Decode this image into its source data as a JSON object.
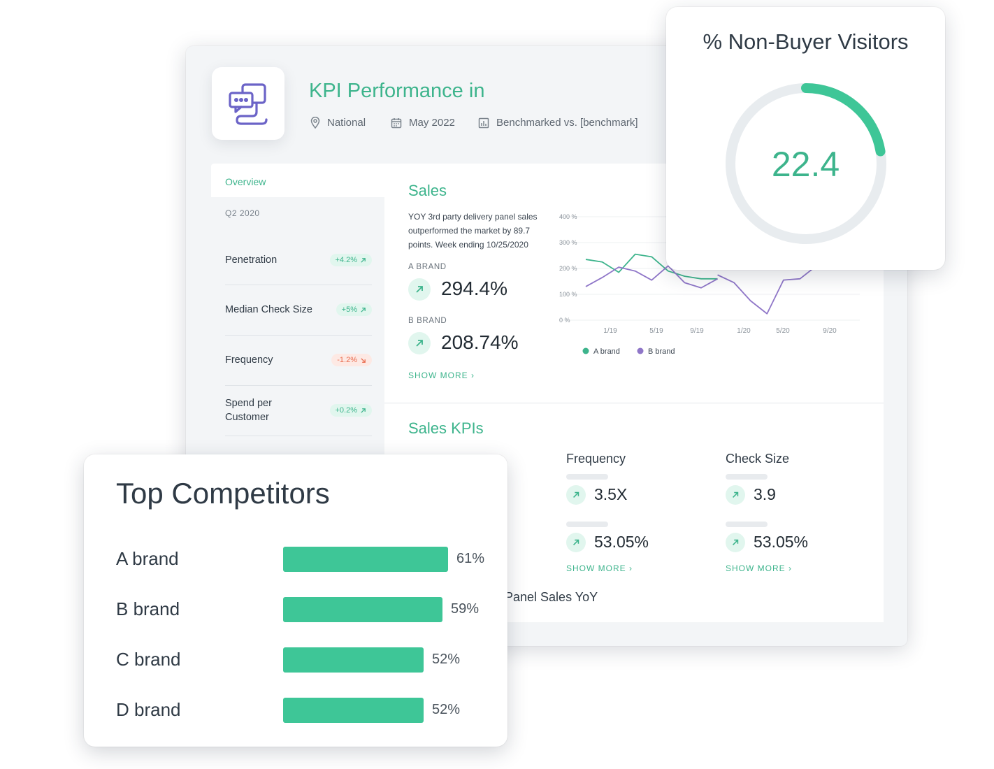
{
  "header": {
    "title": "KPI Performance in",
    "location": "National",
    "date": "May 2022",
    "benchmark": "Benchmarked vs. [benchmark]",
    "icons": [
      "chat-bubbles-icon",
      "location-pin-icon",
      "calendar-icon",
      "bar-chart-icon"
    ]
  },
  "sidebar": {
    "overview_label": "Overview",
    "quarter": "Q2 2020",
    "items": [
      {
        "label": "Penetration",
        "delta": "+4.2%",
        "direction": "up"
      },
      {
        "label": "Median Check Size",
        "delta": "+5%",
        "direction": "up"
      },
      {
        "label": "Frequency",
        "delta": "-1.2%",
        "direction": "down"
      },
      {
        "label": "Spend per Customer",
        "delta": "+0.2%",
        "direction": "up"
      }
    ]
  },
  "sales": {
    "title": "Sales",
    "description": "YOY 3rd party delivery panel sales outperformed the market by 89.7 points. Week ending 10/25/2020",
    "a_brand_label": "A BRAND",
    "a_brand_value": "294.4%",
    "b_brand_label": "B BRAND",
    "b_brand_value": "208.74%",
    "show_more": "SHOW MORE"
  },
  "chart_data": {
    "type": "line",
    "title": "",
    "y_ticks": [
      "0 %",
      "100 %",
      "200 %",
      "300 %",
      "400 %"
    ],
    "x_ticks": [
      "1/19",
      "5/19",
      "9/19",
      "1/20",
      "5/20",
      "9/20"
    ],
    "ylim": [
      0,
      400
    ],
    "series": [
      {
        "name": "A brand",
        "color": "#3db48c",
        "x": [
          0,
          1,
          2,
          3,
          4,
          5,
          6,
          7,
          8
        ],
        "values": [
          235,
          225,
          185,
          255,
          245,
          190,
          170,
          160,
          160
        ]
      },
      {
        "name": "B brand",
        "color": "#8f76c8",
        "x": [
          0,
          1,
          2,
          3,
          4,
          5,
          6,
          7,
          8
        ],
        "values": [
          130,
          165,
          205,
          190,
          155,
          210,
          145,
          125,
          160
        ]
      },
      {
        "name": "B brand",
        "color": "#8f76c8",
        "x": [
          8,
          9,
          10,
          11,
          12,
          13,
          14
        ],
        "values": [
          175,
          145,
          75,
          25,
          155,
          160,
          210
        ]
      }
    ],
    "legend": [
      {
        "name": "A brand",
        "color": "#3db48c"
      },
      {
        "name": "B brand",
        "color": "#8f76c8"
      }
    ],
    "legend_position": "bottom-left"
  },
  "sales_kpis": {
    "title": "Sales KPIs",
    "frequency": {
      "label": "Frequency",
      "value1": "3.5X",
      "value2": "53.05%",
      "show_more": "SHOW MORE"
    },
    "check_size": {
      "label": "Check Size",
      "value1": "3.9",
      "value2": "53.05%",
      "show_more": "SHOW MORE"
    },
    "panel_sales_label": "Panel Sales YoY"
  },
  "non_buyer": {
    "title": "% Non-Buyer Visitors",
    "value": "22.4",
    "percent": 22.4,
    "ring_color": "#3ec697",
    "track_color": "#e8ecef"
  },
  "competitors": {
    "title": "Top Competitors",
    "bar_color": "#3ec697",
    "items": [
      {
        "name": "A brand",
        "pct_label": "61%",
        "pct": 61
      },
      {
        "name": "B brand",
        "pct_label": "59%",
        "pct": 59
      },
      {
        "name": "C brand",
        "pct_label": "52%",
        "pct": 52
      },
      {
        "name": "D brand",
        "pct_label": "52%",
        "pct": 52
      }
    ]
  }
}
